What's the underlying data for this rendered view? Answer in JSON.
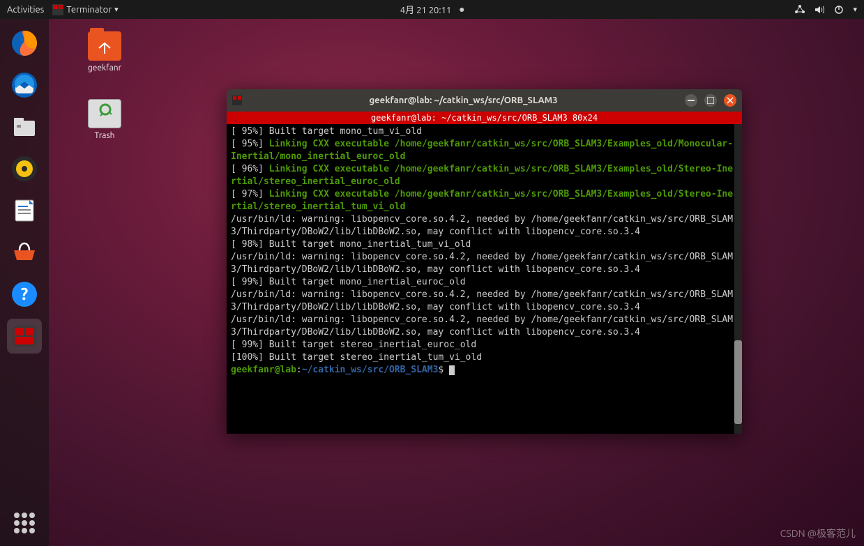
{
  "topbar": {
    "activities": "Activities",
    "app_menu": "Terminator",
    "clock": "4月 21  20:11"
  },
  "desktop": {
    "home_folder": "geekfanr",
    "trash": "Trash"
  },
  "watermark": "CSDN @极客范儿",
  "terminal": {
    "window_title": "geekfanr@lab: ~/catkin_ws/src/ORB_SLAM3",
    "tab_title": "geekfanr@lab: ~/catkin_ws/src/ORB_SLAM3 80x24",
    "lines": [
      {
        "plain": "[ 95%] Built target mono_tum_vi_old"
      },
      {
        "pct": "[ 95%] ",
        "green": "Linking CXX executable /home/geekfanr/catkin_ws/src/ORB_SLAM3/Examples_old/Monocular-Inertial/mono_inertial_euroc_old"
      },
      {
        "pct": "[ 96%] ",
        "green": "Linking CXX executable /home/geekfanr/catkin_ws/src/ORB_SLAM3/Examples_old/Stereo-Inertial/stereo_inertial_euroc_old"
      },
      {
        "pct": "[ 97%] ",
        "green": "Linking CXX executable /home/geekfanr/catkin_ws/src/ORB_SLAM3/Examples_old/Stereo-Inertial/stereo_inertial_tum_vi_old"
      },
      {
        "plain": "/usr/bin/ld: warning: libopencv_core.so.4.2, needed by /home/geekfanr/catkin_ws/src/ORB_SLAM3/Thirdparty/DBoW2/lib/libDBoW2.so, may conflict with libopencv_core.so.3.4"
      },
      {
        "plain": "[ 98%] Built target mono_inertial_tum_vi_old"
      },
      {
        "plain": "/usr/bin/ld: warning: libopencv_core.so.4.2, needed by /home/geekfanr/catkin_ws/src/ORB_SLAM3/Thirdparty/DBoW2/lib/libDBoW2.so, may conflict with libopencv_core.so.3.4"
      },
      {
        "plain": "[ 99%] Built target mono_inertial_euroc_old"
      },
      {
        "plain": "/usr/bin/ld: warning: libopencv_core.so.4.2, needed by /home/geekfanr/catkin_ws/src/ORB_SLAM3/Thirdparty/DBoW2/lib/libDBoW2.so, may conflict with libopencv_core.so.3.4"
      },
      {
        "plain": "/usr/bin/ld: warning: libopencv_core.so.4.2, needed by /home/geekfanr/catkin_ws/src/ORB_SLAM3/Thirdparty/DBoW2/lib/libDBoW2.so, may conflict with libopencv_core.so.3.4"
      },
      {
        "plain": "[ 99%] Built target stereo_inertial_euroc_old"
      },
      {
        "plain": "[100%] Built target stereo_inertial_tum_vi_old"
      }
    ],
    "prompt": {
      "user": "geekfanr@lab",
      "sep": ":",
      "path": "~/catkin_ws/src/ORB_SLAM3",
      "end": "$"
    }
  }
}
